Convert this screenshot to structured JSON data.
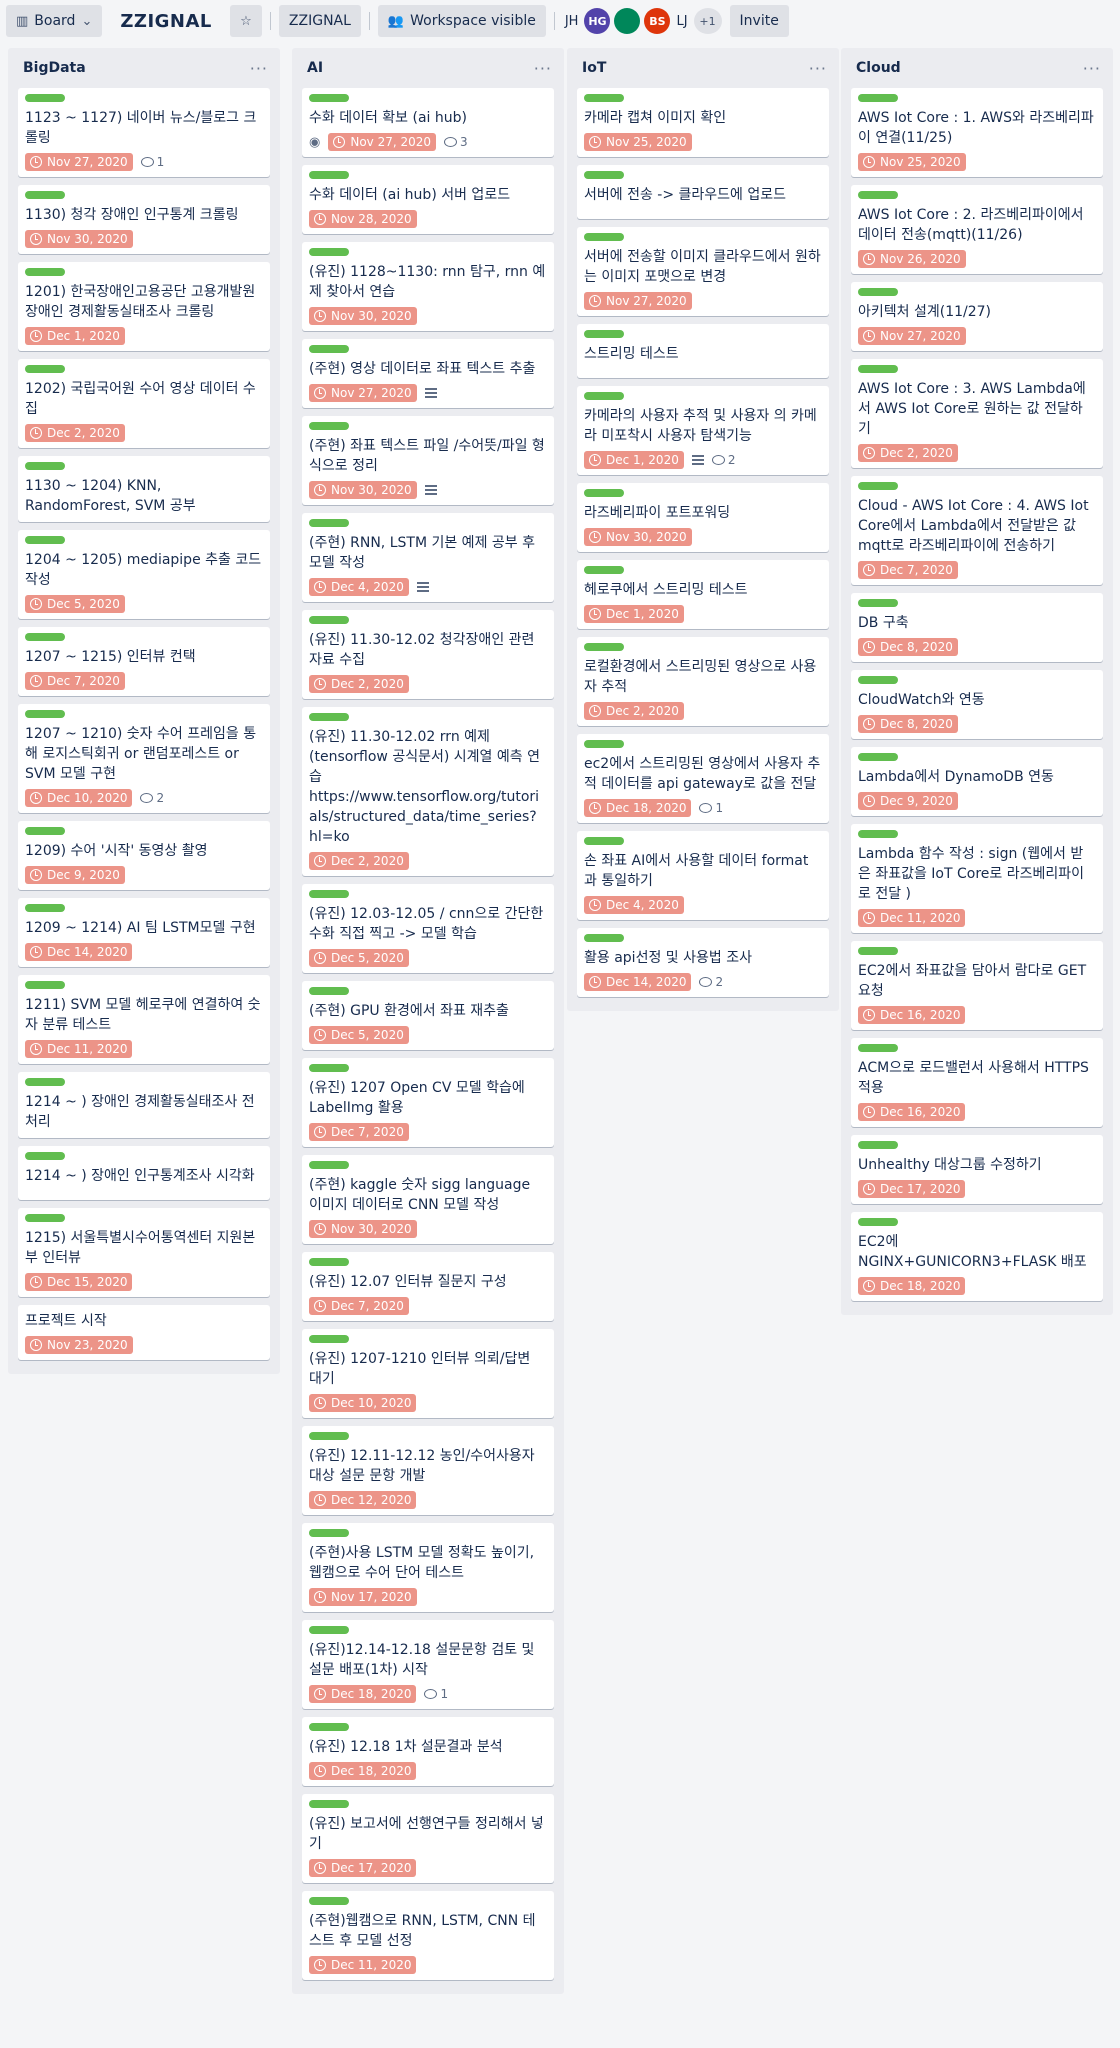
{
  "topbar": {
    "board_menu_label": "Board",
    "board_title": "ZZIGNAL",
    "workspace_label": "ZZIGNAL",
    "visibility_label": "Workspace visible",
    "members": [
      {
        "initials": "JH",
        "color": ""
      },
      {
        "initials": "HG",
        "color": "#5243aa"
      },
      {
        "initials": "",
        "color": "#00875a"
      },
      {
        "initials": "BS",
        "color": "#de350b"
      },
      {
        "initials": "LJ",
        "color": ""
      }
    ],
    "more_members": "+1",
    "invite_label": "Invite"
  },
  "lists": [
    {
      "title": "BigData",
      "cards": [
        {
          "title": "1123 ~ 1127) 네이버 뉴스/블로그 크롤링",
          "due": "Nov 27, 2020",
          "comments": "1"
        },
        {
          "title": "1130) 청각 장애인 인구통계 크롤링",
          "due": "Nov 30, 2020"
        },
        {
          "title": "1201) 한국장애인고용공단 고용개발원 장애인 경제활동실태조사 크롤링",
          "due": "Dec 1, 2020"
        },
        {
          "title": "1202) 국립국어원 수어 영상 데이터 수집",
          "due": "Dec 2, 2020"
        },
        {
          "title": "1130 ~ 1204) KNN, RandomForest, SVM 공부"
        },
        {
          "title": "1204 ~ 1205) mediapipe 추출 코드작성",
          "due": "Dec 5, 2020"
        },
        {
          "title": "1207 ~ 1215) 인터뷰 컨택",
          "due": "Dec 7, 2020"
        },
        {
          "title": "1207 ~ 1210) 숫자 수어 프레임을 통해 로지스틱회귀 or 랜덤포레스트 or SVM 모델 구현",
          "due": "Dec 10, 2020",
          "comments": "2"
        },
        {
          "title": "1209) 수어 '시작' 동영상 촬영",
          "due": "Dec 9, 2020"
        },
        {
          "title": "1209 ~ 1214) AI 팀 LSTM모델 구현",
          "due": "Dec 14, 2020"
        },
        {
          "title": "1211) SVM 모델 헤로쿠에 연결하여 숫자 분류 테스트",
          "due": "Dec 11, 2020"
        },
        {
          "title": "1214 ~ ) 장애인 경제활동실태조사 전처리"
        },
        {
          "title": "1214 ~ ) 장애인 인구통계조사 시각화"
        },
        {
          "title": "1215) 서울특별시수어통역센터 지원본부 인터뷰",
          "due": "Dec 15, 2020"
        },
        {
          "title": "프로젝트 시작",
          "due": "Nov 23, 2020",
          "nolabel": true
        }
      ]
    },
    {
      "title": "AI",
      "cards": [
        {
          "title": "수화 데이터 확보 (ai hub)",
          "due": "Nov 27, 2020",
          "comments": "3",
          "watch": true
        },
        {
          "title": "수화 데이터 (ai hub) 서버 업로드",
          "due": "Nov 28, 2020"
        },
        {
          "title": "(유진) 1128~1130: rnn 탐구, rnn 예제 찾아서 연습",
          "due": "Nov 30, 2020"
        },
        {
          "title": "(주현) 영상 데이터로 좌표 텍스트 추출",
          "due": "Nov 27, 2020",
          "desc": true
        },
        {
          "title": "(주현) 좌표 텍스트 파일 /수어뜻/파일 형식으로 정리",
          "due": "Nov 30, 2020",
          "desc": true
        },
        {
          "title": "(주현) RNN, LSTM 기본 예제 공부 후 모델 작성",
          "due": "Dec 4, 2020",
          "desc": true
        },
        {
          "title": "(유진) 11.30-12.02 청각장애인 관련 자료 수집",
          "due": "Dec 2, 2020"
        },
        {
          "title": "(유진) 11.30-12.02 rrn 예제 (tensorflow 공식문서) 시계열 예측 연습 https://www.tensorflow.org/tutorials/structured_data/time_series?hl=ko",
          "due": "Dec 2, 2020"
        },
        {
          "title": "(유진) 12.03-12.05 / cnn으로 간단한 수화 직접 찍고 -> 모델 학습",
          "due": "Dec 5, 2020"
        },
        {
          "title": "(주현) GPU 환경에서 좌표 재추출",
          "due": "Dec 5, 2020"
        },
        {
          "title": "(유진) 1207 Open CV 모델 학습에 LabelImg 활용",
          "due": "Dec 7, 2020"
        },
        {
          "title": "(주현) kaggle 숫자 sigg language 이미지 데이터로 CNN 모델 작성",
          "due": "Nov 30, 2020"
        },
        {
          "title": "(유진) 12.07 인터뷰 질문지 구성",
          "due": "Dec 7, 2020"
        },
        {
          "title": "(유진) 1207-1210 인터뷰 의뢰/답변 대기",
          "due": "Dec 10, 2020"
        },
        {
          "title": "(유진) 12.11-12.12 농인/수어사용자 대상 설문 문항 개발",
          "due": "Dec 12, 2020"
        },
        {
          "title": "(주현)사용 LSTM 모델 정확도 높이기, 웹캠으로 수어 단어 테스트",
          "due": "Nov 17, 2020"
        },
        {
          "title": "(유진)12.14-12.18 설문문항 검토 및 설문 배포(1차) 시작",
          "due": "Dec 18, 2020",
          "comments": "1"
        },
        {
          "title": "(유진) 12.18 1차 설문결과 분석",
          "due": "Dec 18, 2020"
        },
        {
          "title": "(유진) 보고서에 선행연구들 정리해서 넣기",
          "due": "Dec 17, 2020"
        },
        {
          "title": "(주현)웹캠으로 RNN, LSTM, CNN 테스트 후 모델 선정",
          "due": "Dec 11, 2020"
        }
      ]
    },
    {
      "title": "IoT",
      "cards": [
        {
          "title": "카메라 캡쳐 이미지 확인",
          "due": "Nov 25, 2020"
        },
        {
          "title": "서버에 전송 -> 클라우드에 업로드"
        },
        {
          "title": "서버에 전송할 이미지 클라우드에서 원하는 이미지 포맷으로 변경",
          "due": "Nov 27, 2020"
        },
        {
          "title": "스트리밍 테스트"
        },
        {
          "title": "카메라의 사용자 추적 및 사용자 의 카메라 미포착시 사용자 탐색기능",
          "due": "Dec 1, 2020",
          "desc": true,
          "comments": "2"
        },
        {
          "title": "라즈베리파이 포트포워딩",
          "due": "Nov 30, 2020"
        },
        {
          "title": "헤로쿠에서 스트리밍 테스트",
          "due": "Dec 1, 2020"
        },
        {
          "title": "로컬환경에서 스트리밍된 영상으로 사용자 추적",
          "due": "Dec 2, 2020"
        },
        {
          "title": "ec2에서 스트리밍된 영상에서 사용자 추적 데이터를 api gateway로 값을 전달",
          "due": "Dec 18, 2020",
          "comments": "1"
        },
        {
          "title": "손 좌표 AI에서 사용할 데이터 format과 통일하기",
          "due": "Dec 4, 2020"
        },
        {
          "title": "활용 api선정 및 사용법 조사",
          "due": "Dec 14, 2020",
          "comments": "2"
        }
      ]
    },
    {
      "title": "Cloud",
      "cards": [
        {
          "title": "AWS Iot Core : 1. AWS와 라즈베리파이 연결(11/25)",
          "due": "Nov 25, 2020"
        },
        {
          "title": "AWS Iot Core : 2. 라즈베리파이에서 데이터 전송(mqtt)(11/26)",
          "due": "Nov 26, 2020"
        },
        {
          "title": "아키텍처 설계(11/27)",
          "due": "Nov 27, 2020"
        },
        {
          "title": "AWS Iot Core : 3. AWS Lambda에서 AWS Iot Core로 원하는 값 전달하기",
          "due": "Dec 2, 2020"
        },
        {
          "title": "Cloud - AWS Iot Core : 4. AWS Iot Core에서 Lambda에서 전달받은 값 mqtt로 라즈베리파이에 전송하기",
          "due": "Dec 7, 2020"
        },
        {
          "title": "DB 구축",
          "due": "Dec 8, 2020"
        },
        {
          "title": "CloudWatch와 연동",
          "due": "Dec 8, 2020"
        },
        {
          "title": "Lambda에서 DynamoDB 연동",
          "due": "Dec 9, 2020"
        },
        {
          "title": "Lambda 함수 작성 : sign (웹에서 받은 좌표값을 IoT Core로 라즈베리파이로 전달 )",
          "due": "Dec 11, 2020"
        },
        {
          "title": "EC2에서 좌표값을 담아서 람다로 GET 요청",
          "due": "Dec 16, 2020"
        },
        {
          "title": "ACM으로 로드밸런서 사용해서 HTTPS 적용",
          "due": "Dec 16, 2020"
        },
        {
          "title": "Unhealthy 대상그룹 수정하기",
          "due": "Dec 17, 2020"
        },
        {
          "title": "EC2에 NGINX+GUNICORN3+FLASK 배포",
          "due": "Dec 18, 2020"
        }
      ]
    }
  ]
}
